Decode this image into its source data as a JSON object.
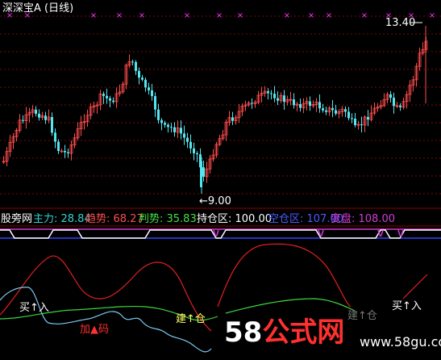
{
  "top_panel": {
    "title": "深深宝A (日线)",
    "high_label": "13.40",
    "low_label": "9.00",
    "markers": "×"
  },
  "indicator_bar": {
    "name": "股旁网",
    "items": [
      {
        "label": "主力:",
        "value": "28.84",
        "color": "#35d1d1"
      },
      {
        "label": "趋势:",
        "value": "68.27",
        "color": "#ff4d4d"
      },
      {
        "label": "判势:",
        "value": "35.83",
        "color": "#44e044"
      },
      {
        "label": "持仓区:",
        "value": "100.00",
        "color": "#ffffff"
      },
      {
        "label": "空仓区:",
        "value": "107.00",
        "color": "#4f5bff"
      },
      {
        "label": "变盘:",
        "value": "108.00",
        "color": "#d63bd6"
      }
    ]
  },
  "signals": {
    "buy1": "买↑入",
    "add": "加▲码",
    "build": "建↑仓",
    "ghost1": "建↑仓",
    "buy2": "买↑入"
  },
  "watermark": {
    "logo_digits": "58",
    "logo_text": "公式网",
    "url": "www.58gu.com"
  },
  "colors": {
    "up_candle": "#ff4d4d",
    "down_candle": "#53e6f0",
    "grid": "#7a0a0a",
    "marker": "#ff33ff",
    "main_force": "#7cc8f0",
    "trend": "#e02020",
    "judge": "#3cd43c"
  },
  "chart_data": {
    "type": "candlestick",
    "price_high": 13.4,
    "price_low": 9.0,
    "indicators": {
      "主力": 28.84,
      "趋势": 68.27,
      "判势": 35.83,
      "持仓区": 100.0,
      "空仓区": 107.0,
      "变盘": 108.0
    }
  }
}
